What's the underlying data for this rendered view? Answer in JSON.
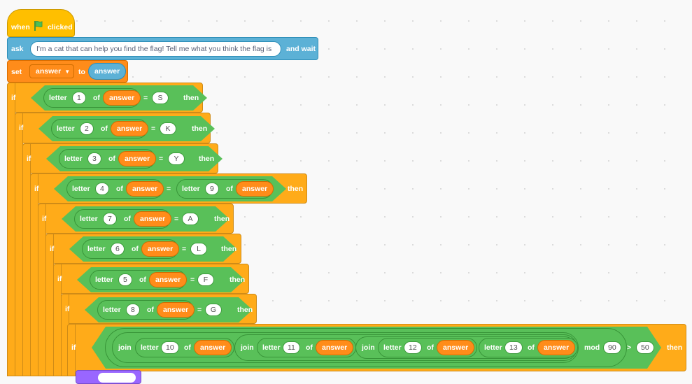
{
  "event_block": {
    "when": "when",
    "clicked": "clicked",
    "flag_icon": "green-flag-icon",
    "flag_color": "#4cbf56"
  },
  "ask_block": {
    "ask": "ask",
    "question": "I'm a cat that can help you find the flag! Tell me what you think the flag is",
    "and_wait": "and wait"
  },
  "set_block": {
    "set": "set",
    "variable": "answer",
    "to": "to",
    "value": "answer"
  },
  "keywords": {
    "if": "if",
    "then": "then",
    "letter": "letter",
    "of": "of",
    "eq": "=",
    "join": "join",
    "mod": "mod",
    "gt": ">"
  },
  "conditions": [
    {
      "letter": "1",
      "var": "answer",
      "value": "S"
    },
    {
      "letter": "2",
      "var": "answer",
      "value": "K"
    },
    {
      "letter": "3",
      "var": "answer",
      "value": "Y"
    },
    {
      "letter": "4",
      "var": "answer",
      "letter_b": "9",
      "var_b": "answer"
    },
    {
      "letter": "7",
      "var": "answer",
      "value": "A"
    },
    {
      "letter": "6",
      "var": "answer",
      "value": "L"
    },
    {
      "letter": "5",
      "var": "answer",
      "value": "F"
    },
    {
      "letter": "8",
      "var": "answer",
      "value": "G"
    }
  ],
  "final_condition": {
    "letters": [
      "10",
      "11",
      "12",
      "13"
    ],
    "var": "answer",
    "mod_value": "90",
    "gt_value": "50"
  },
  "colors": {
    "events": "#ffbf00",
    "control": "#ffab19",
    "operators": "#59c059",
    "variables": "#ff8c1a",
    "sensing": "#5cb1d6",
    "looks": "#9966ff"
  }
}
